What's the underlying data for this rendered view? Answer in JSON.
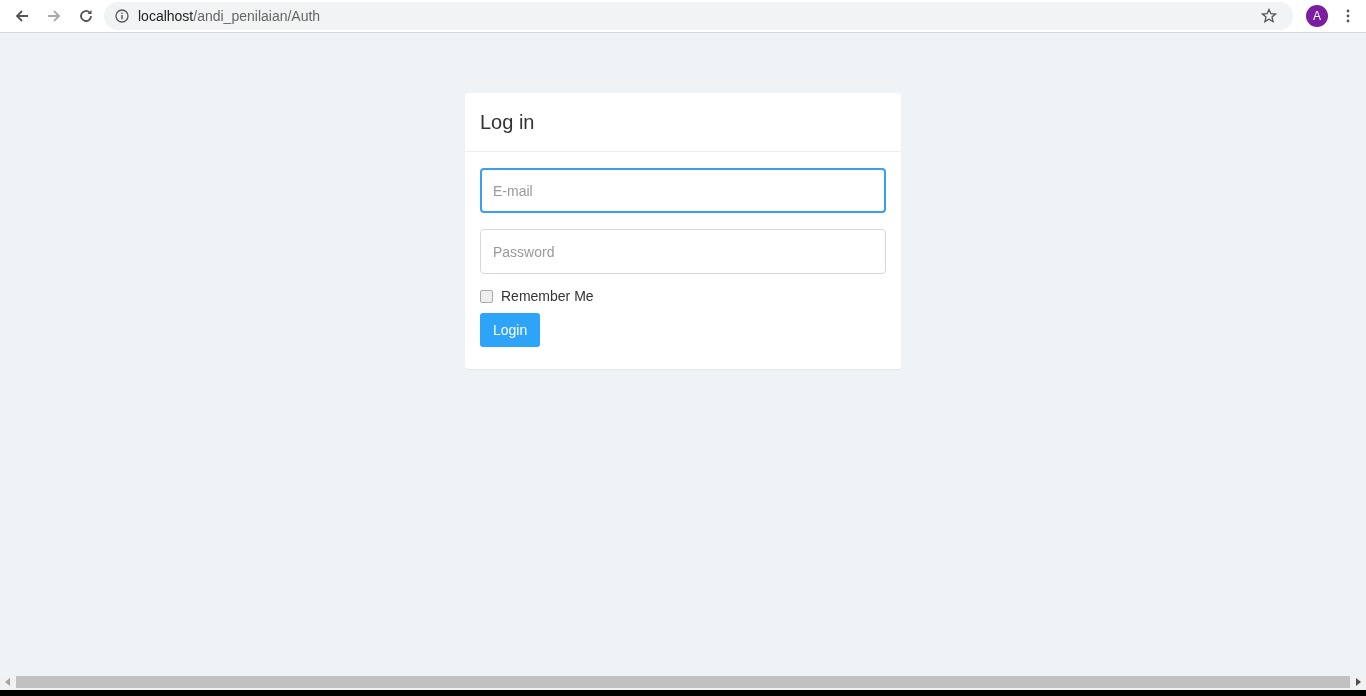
{
  "browser": {
    "url_host": "localhost",
    "url_path": "/andi_penilaian/Auth",
    "profile_initial": "A"
  },
  "login": {
    "title": "Log in",
    "fields": [
      {
        "placeholder": "E-mail",
        "focused": true
      },
      {
        "placeholder": "Password",
        "focused": false
      }
    ],
    "remember": {
      "label": "Remember Me",
      "checked": false
    },
    "button": "Login"
  }
}
